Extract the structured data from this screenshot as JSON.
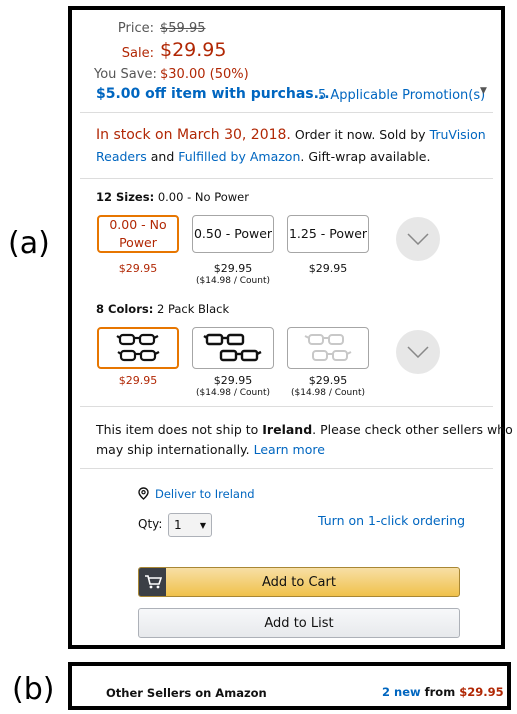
{
  "labels": {
    "a": "(a)",
    "b": "(b)"
  },
  "pricing": {
    "price_label": "Price:",
    "list_price": "$59.95",
    "sale_label": "Sale:",
    "sale_price": "$29.95",
    "save_label": "You Save:",
    "save_value": "$30.00 (50%)"
  },
  "promo": {
    "text": "$5.00 off item with purchas...",
    "count": "5 Applicable Promotion(s)"
  },
  "stock": {
    "status": "In stock on March 30, 2018.",
    "order_text": " Order it now. Sold by ",
    "seller": "TruVision Readers",
    "and_text": " and ",
    "fulfilled": "Fulfilled by Amazon",
    "giftwrap": ". Gift-wrap available."
  },
  "sizes": {
    "count_label": "12 Sizes:",
    "selected": "0.00 - No Power",
    "options": [
      {
        "label_line1": "0.00 - No",
        "label_line2": "Power",
        "price": "$29.95",
        "sub": ""
      },
      {
        "label_line1": "0.50 - Power",
        "label_line2": "",
        "price": "$29.95",
        "sub": "($14.98 / Count)"
      },
      {
        "label_line1": "1.25 - Power",
        "label_line2": "",
        "price": "$29.95",
        "sub": ""
      }
    ]
  },
  "colors": {
    "count_label": "8 Colors:",
    "selected": "2 Pack Black",
    "options": [
      {
        "icon": "glasses-black-pair-icon",
        "price": "$29.95",
        "sub": ""
      },
      {
        "icon": "glasses-black-pair-icon",
        "price": "$29.95",
        "sub": "($14.98 / Count)"
      },
      {
        "icon": "glasses-clear-pair-icon",
        "price": "$29.95",
        "sub": "($14.98 / Count)"
      }
    ]
  },
  "shipping": {
    "text1": "This item does not ship to ",
    "country": "Ireland",
    "text2": ". Please check other sellers who",
    "text3": "may ship internationally. ",
    "learn_more": "Learn more"
  },
  "buy_box": {
    "deliver_to": "Deliver to Ireland",
    "qty_label": "Qty:",
    "qty_value": "1",
    "one_click": "Turn on 1-click ordering",
    "add_to_cart": "Add to Cart",
    "add_to_list": "Add to List"
  },
  "other_sellers": {
    "title": "Other Sellers on Amazon",
    "count": "2 new",
    "from_text": " from ",
    "price": "$29.95"
  },
  "colors_theme": {
    "price_red": "#b12704",
    "link_blue": "#0066c0",
    "selected_orange": "#e77600",
    "cart_yellow": "#f0c14b"
  }
}
